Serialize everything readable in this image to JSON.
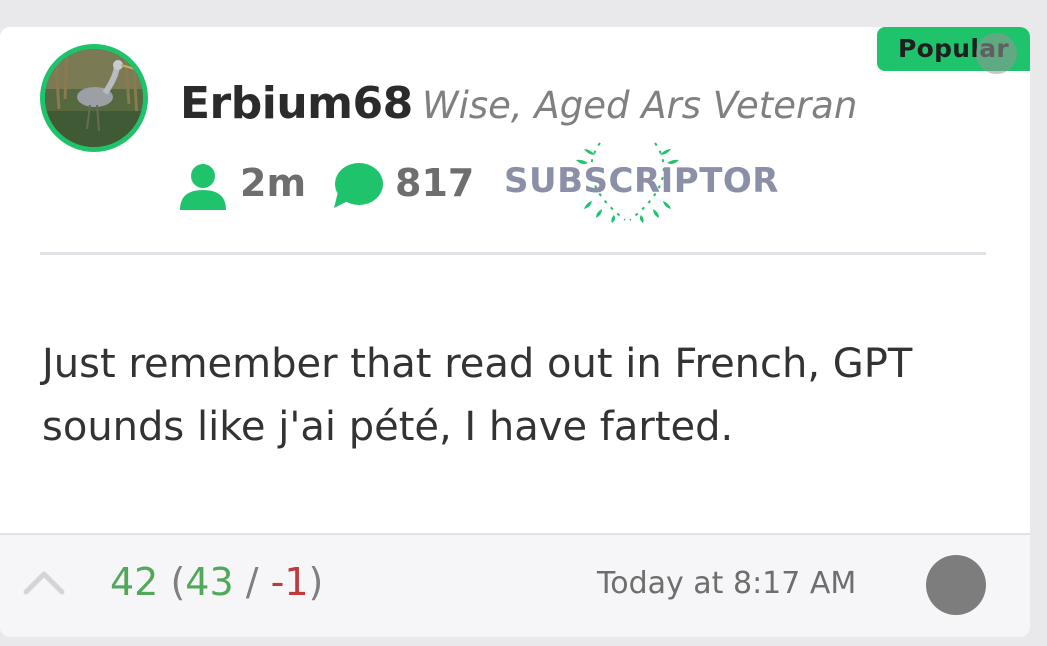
{
  "post": {
    "badge": "Popular",
    "author": {
      "username": "Erbium68",
      "title": "Wise, Aged Ars Veteran",
      "member_stat": "2m",
      "comment_count": "817",
      "subscriptor_label": "SUBSCRIPTOR"
    },
    "body": "Just remember that read out in French, GPT sounds like j'ai pété, I have farted.",
    "votes": {
      "total": "42",
      "open_paren": "(",
      "up": "43",
      "separator": " / ",
      "down": "-1",
      "close_paren": ")"
    },
    "timestamp": "Today at 8:17 AM"
  },
  "colors": {
    "accent": "#1ec36b",
    "positive": "#52a85a",
    "negative": "#c0393b"
  },
  "icons": [
    "user-icon",
    "comment-bubble-icon",
    "laurel-icon",
    "upvote-chevron-icon",
    "more-options-icon"
  ]
}
